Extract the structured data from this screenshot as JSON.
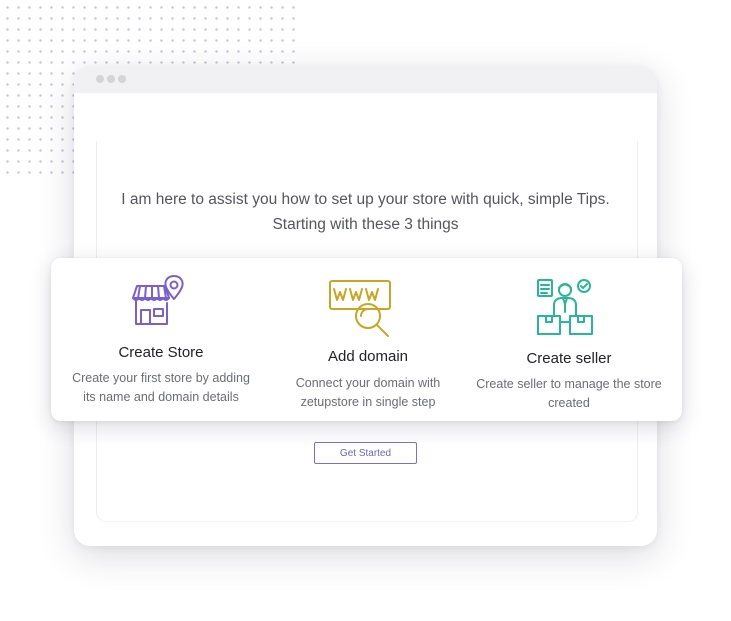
{
  "intro": {
    "line1": "I am here to assist you how to set up your store with quick, simple Tips.",
    "line2": "Starting with these 3 things"
  },
  "cards": [
    {
      "icon": "store-location-icon",
      "title": "Create Store",
      "desc_line1": "Create your first store by adding",
      "desc_line2": "its name and domain details"
    },
    {
      "icon": "www-search-icon",
      "title": "Add domain",
      "desc_line1": "Connect your domain with",
      "desc_line2": "zetupstore in single step"
    },
    {
      "icon": "seller-icon",
      "title": "Create seller",
      "desc_line1": "Create seller to manage the store",
      "desc_line2": "created"
    }
  ],
  "button": {
    "label": "Get Started"
  },
  "colors": {
    "store_icon": "#7a5fd0",
    "domain_icon": "#c8a524",
    "seller_icon": "#2bb597",
    "button_border": "#7c72c4"
  }
}
